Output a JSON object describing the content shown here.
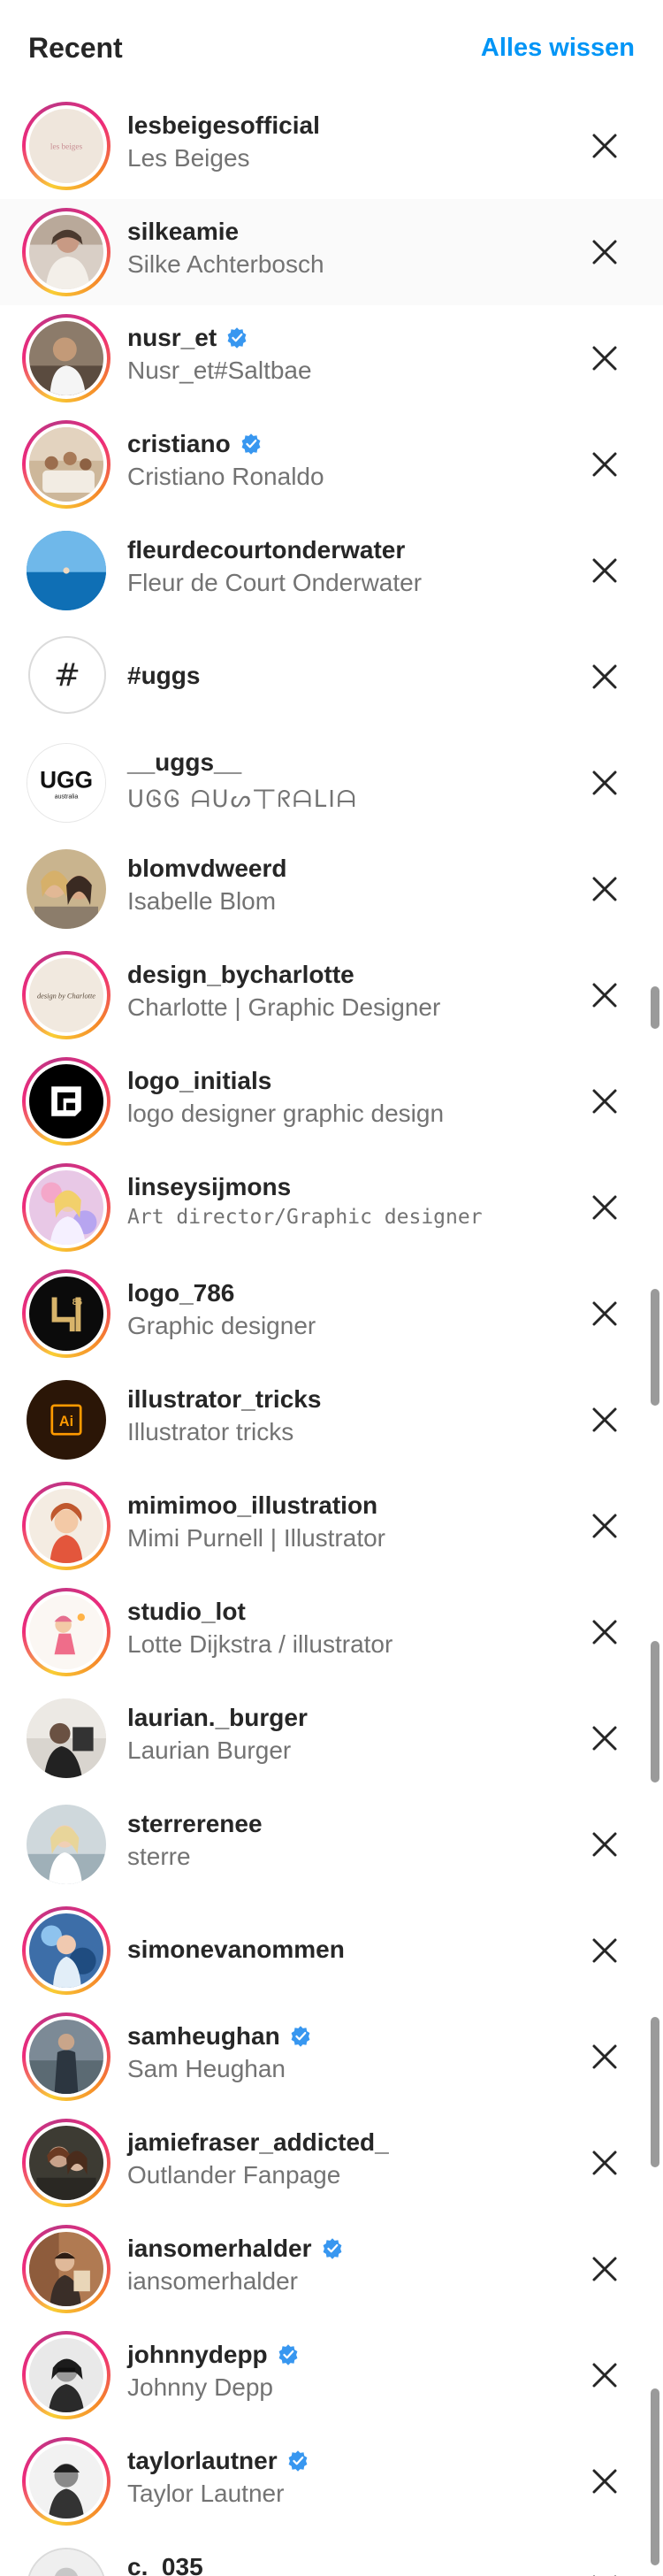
{
  "header": {
    "title": "Recent",
    "clear_all": "Alles wissen"
  },
  "colors": {
    "accent": "#0095f6",
    "verified": "#3897f0",
    "muted": "#737373"
  },
  "rows": [
    {
      "username": "lesbeigesofficial",
      "fullname": "Les Beiges",
      "verified": false,
      "avatar_logo": "les beiges"
    },
    {
      "username": "silkeamie",
      "fullname": "Silke Achterbosch",
      "verified": false
    },
    {
      "username": "nusr_et",
      "fullname": "Nusr_et#Saltbae",
      "verified": true
    },
    {
      "username": "cristiano",
      "fullname": "Cristiano Ronaldo",
      "verified": true
    },
    {
      "username": "fleurdecourtonderwater",
      "fullname": "Fleur de Court Onderwater",
      "verified": false
    },
    {
      "username": "#uggs",
      "fullname": "",
      "verified": false,
      "hashtag_symbol": "#"
    },
    {
      "username": "__uggs__",
      "fullname": "ᑌᎶᎶ ᗩᑌᔕ丅ᖇᗩᒪIᗩ",
      "verified": false,
      "avatar_logo": "UGG",
      "avatar_sub": "australia"
    },
    {
      "username": "blomvdweerd",
      "fullname": "Isabelle Blom",
      "verified": false
    },
    {
      "username": "design_bycharlotte",
      "fullname": "Charlotte | Graphic Designer",
      "verified": false,
      "avatar_logo": "design by Charlotte"
    },
    {
      "username": "logo_initials",
      "fullname": "logo designer graphic design",
      "verified": false
    },
    {
      "username": "linseysijmons",
      "fullname": "Art director/Graphic designer",
      "verified": false
    },
    {
      "username": "logo_786",
      "fullname": "Graphic designer",
      "verified": false,
      "avatar_logo": "86"
    },
    {
      "username": "illustrator_tricks",
      "fullname": "Illustrator tricks",
      "verified": false,
      "avatar_logo": "Ai"
    },
    {
      "username": "mimimoo_illustration",
      "fullname": "Mimi Purnell | Illustrator",
      "verified": false
    },
    {
      "username": "studio_lot",
      "fullname": "Lotte Dijkstra / illustrator",
      "verified": false
    },
    {
      "username": "laurian._burger",
      "fullname": "Laurian Burger",
      "verified": false
    },
    {
      "username": "sterrerenee",
      "fullname": "sterre",
      "verified": false
    },
    {
      "username": "simonevanommen",
      "fullname": "",
      "verified": false
    },
    {
      "username": "samheughan",
      "fullname": "Sam Heughan",
      "verified": true
    },
    {
      "username": "jamiefraser_addicted_",
      "fullname": "Outlander Fanpage",
      "verified": false
    },
    {
      "username": "iansomerhalder",
      "fullname": "iansomerhalder",
      "verified": true
    },
    {
      "username": "johnnydepp",
      "fullname": "Johnny Depp",
      "verified": true
    },
    {
      "username": "taylorlautner",
      "fullname": "Taylor Lautner",
      "verified": true
    },
    {
      "username": "c._035",
      "fullname": "",
      "verified": false
    }
  ]
}
